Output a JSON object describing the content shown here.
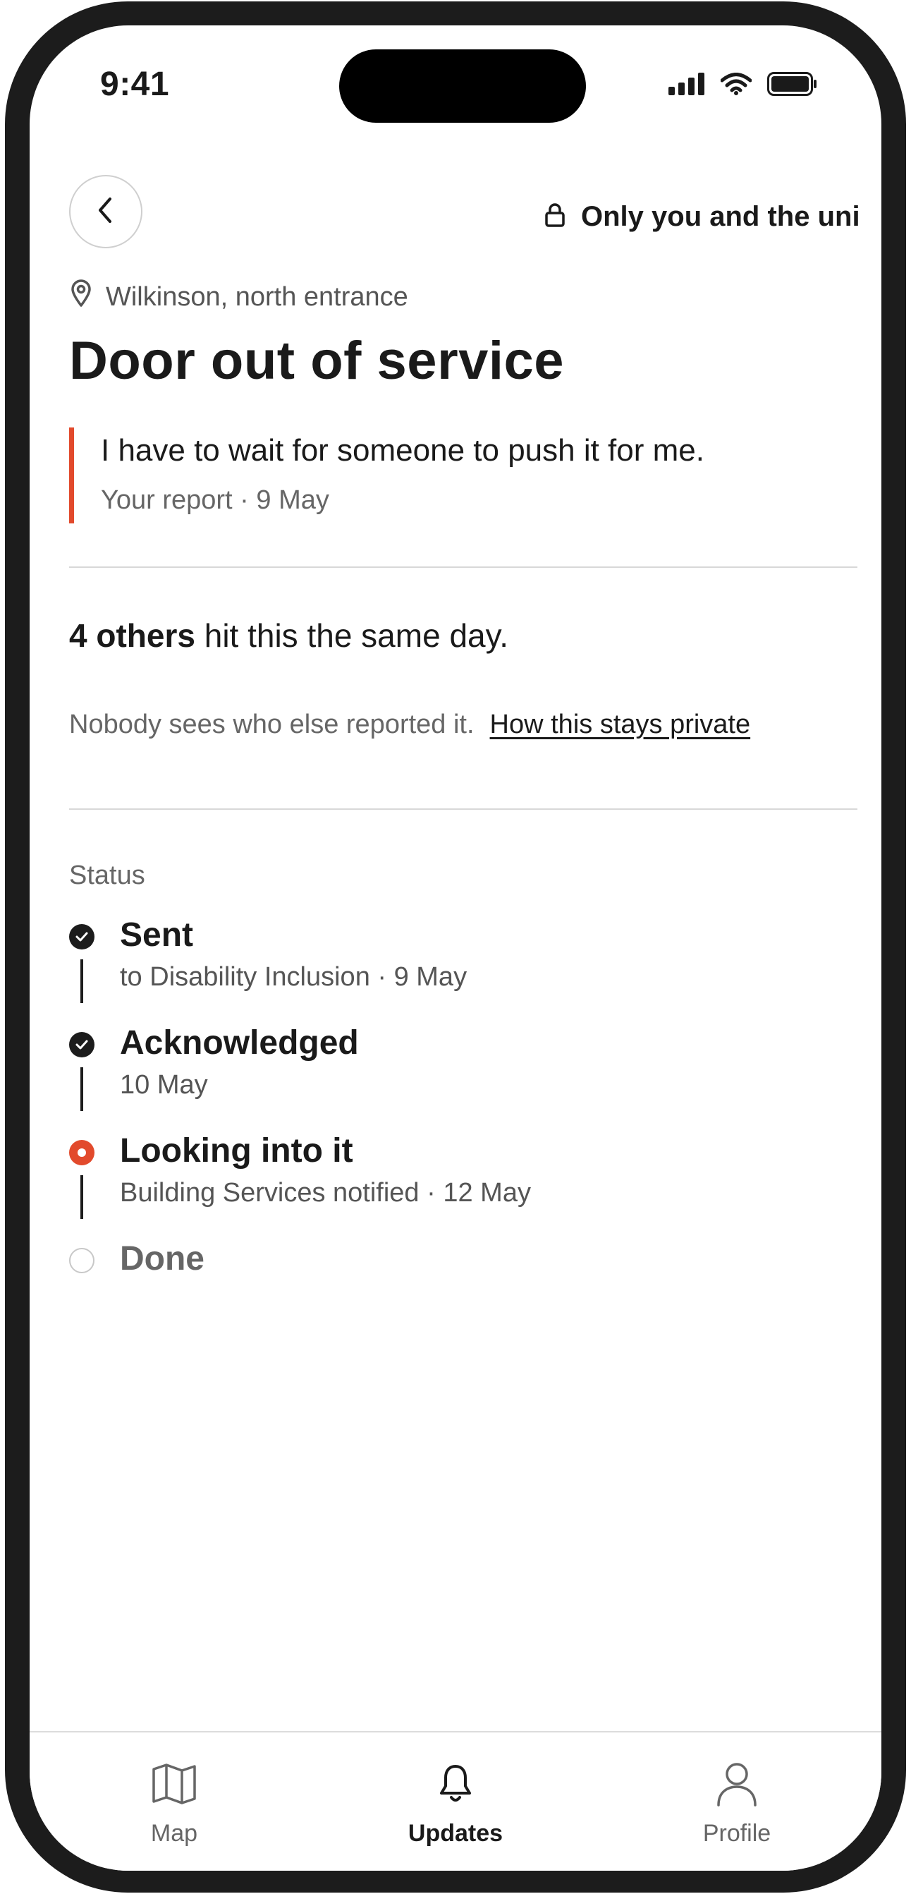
{
  "status_bar": {
    "time": "9:41",
    "icons": [
      "signal-icon",
      "wifi-icon",
      "battery-icon"
    ]
  },
  "header": {
    "back_icon": "chevron-left-icon",
    "privacy_icon": "lock-icon",
    "privacy_label": "Only you and the uni"
  },
  "report": {
    "location_icon": "map-pin-icon",
    "location": "Wilkinson, north entrance",
    "title": "Door out of service",
    "quote": "I have to wait for someone to push it for me.",
    "meta": "Your report · 9 May"
  },
  "others": {
    "count_text": "4 others",
    "rest_text": " hit this the same day.",
    "privacy_note": "Nobody sees who else reported it.",
    "privacy_link": "How this stays private"
  },
  "status": {
    "label": "Status",
    "steps": [
      {
        "title": "Sent",
        "subtitle": "to Disability Inclusion · 9 May",
        "state": "done"
      },
      {
        "title": "Acknowledged",
        "subtitle": "10 May",
        "state": "done"
      },
      {
        "title": "Looking into it",
        "subtitle": "Building Services notified · 12 May",
        "state": "current"
      },
      {
        "title": "Done",
        "subtitle": "",
        "state": "pending"
      }
    ]
  },
  "tabbar": {
    "tabs": [
      {
        "label": "Map",
        "icon": "map-icon",
        "active": false
      },
      {
        "label": "Updates",
        "icon": "bell-icon",
        "active": true
      },
      {
        "label": "Profile",
        "icon": "profile-icon",
        "active": false
      }
    ]
  },
  "colors": {
    "accent": "#e24a2c",
    "text": "#1a1a1a",
    "muted": "#666666",
    "frame": "#1c1c1c"
  }
}
